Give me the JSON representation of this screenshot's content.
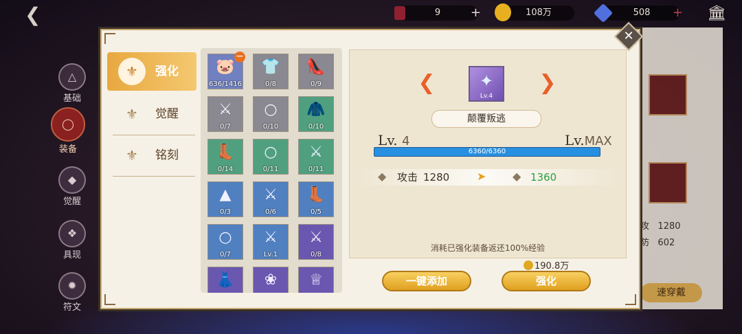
{
  "topbar": {
    "tickets": "9",
    "gold": "108万",
    "gems": "508"
  },
  "left_nav": [
    {
      "label": "基础",
      "icon": "triangle-icon"
    },
    {
      "label": "装备",
      "icon": "helmet-icon",
      "active": true
    },
    {
      "label": "觉醒",
      "icon": "awaken-icon"
    },
    {
      "label": "具现",
      "icon": "orb-icon"
    },
    {
      "label": "符文",
      "icon": "rune-icon"
    }
  ],
  "right_panel": {
    "stat1_label": "攻",
    "stat1_value": "1280",
    "stat2_label": "防",
    "stat2_value": "602",
    "button": "速穿戴"
  },
  "tabs": [
    {
      "label": "强化",
      "active": true
    },
    {
      "label": "觉醒"
    },
    {
      "label": "铭刻"
    }
  ],
  "materials": [
    {
      "count": "636/1416",
      "icon": "pig-icon",
      "bg": "#7080c0"
    },
    {
      "count": "0/8",
      "icon": "shirt-icon",
      "bg": "#8a8890"
    },
    {
      "count": "0/9",
      "icon": "shoes-icon",
      "bg": "#8a8890"
    },
    {
      "count": "0/7",
      "icon": "sword-icon",
      "bg": "#8a8890"
    },
    {
      "count": "0/10",
      "icon": "ring-icon",
      "bg": "#8a8890"
    },
    {
      "count": "0/10",
      "icon": "jacket-icon",
      "bg": "#50a080"
    },
    {
      "count": "0/14",
      "icon": "boots-icon",
      "bg": "#50a080"
    },
    {
      "count": "0/11",
      "icon": "ring-icon",
      "bg": "#50a080"
    },
    {
      "count": "0/11",
      "icon": "sword-icon",
      "bg": "#50a080"
    },
    {
      "count": "0/3",
      "icon": "cloak-icon",
      "bg": "#5080c0"
    },
    {
      "count": "0/6",
      "icon": "sword-icon",
      "bg": "#5080c0"
    },
    {
      "count": "0/5",
      "icon": "boots-icon",
      "bg": "#5080c0"
    },
    {
      "count": "0/7",
      "icon": "ring-icon",
      "bg": "#5080c0"
    },
    {
      "count": "Lv.1",
      "icon": "sword-icon",
      "bg": "#5080c0"
    },
    {
      "count": "0/8",
      "icon": "sword-icon",
      "bg": "#6a58b0"
    },
    {
      "count": "",
      "icon": "dress-icon",
      "bg": "#6a58b0"
    },
    {
      "count": "",
      "icon": "hair-icon",
      "bg": "#6a58b0"
    },
    {
      "count": "",
      "icon": "tiara-icon",
      "bg": "#6a58b0"
    }
  ],
  "detail": {
    "item_level": "Lv.4",
    "item_name": "颠覆叛逃",
    "lv_prefix": "Lv.",
    "lv_current": "4",
    "lv_max": "MAX",
    "exp_text": "6360/6360",
    "exp_fraction": 1.0,
    "stat_label": "攻击",
    "stat_current": "1280",
    "stat_next": "1360",
    "note": "消耗已强化装备返还100%经验",
    "cost": "190.8万",
    "btn_auto": "一键添加",
    "btn_enhance": "强化"
  }
}
